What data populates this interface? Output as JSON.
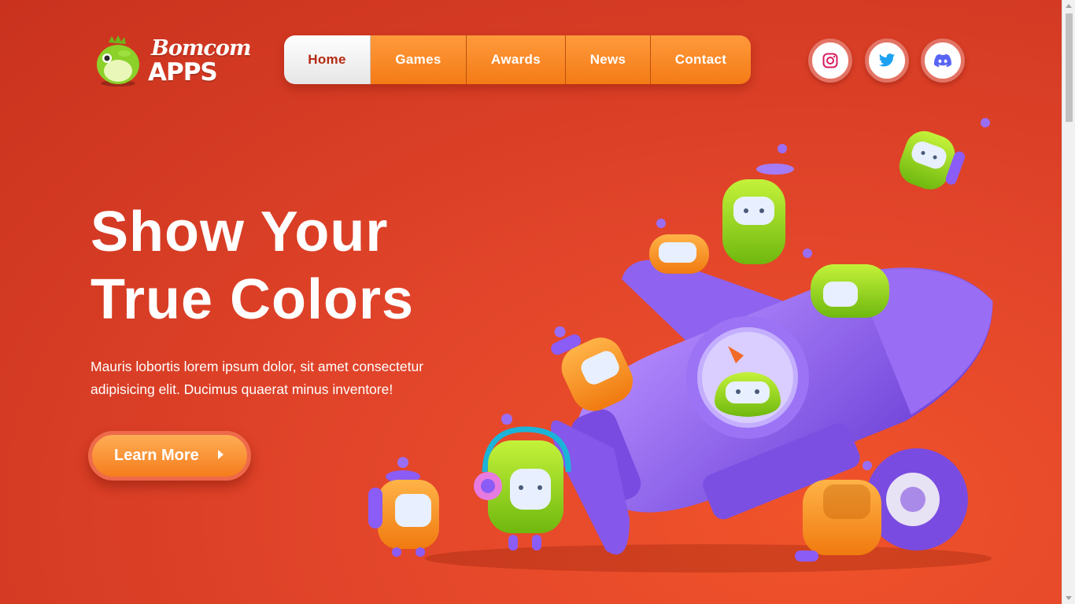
{
  "logo": {
    "line1": "Bomcom",
    "line2": "APPS",
    "mascot_icon": "dino-mascot-icon"
  },
  "nav": {
    "items": [
      {
        "label": "Home",
        "active": true
      },
      {
        "label": "Games",
        "active": false
      },
      {
        "label": "Awards",
        "active": false
      },
      {
        "label": "News",
        "active": false
      },
      {
        "label": "Contact",
        "active": false
      }
    ]
  },
  "social": [
    {
      "name": "instagram",
      "icon": "instagram-icon",
      "color": "#e1306c"
    },
    {
      "name": "twitter",
      "icon": "twitter-icon",
      "color": "#1da1f2"
    },
    {
      "name": "discord",
      "icon": "discord-icon",
      "color": "#7289da"
    }
  ],
  "hero": {
    "title_line1": "Show Your",
    "title_line2": "True Colors",
    "description": "Mauris lobortis lorem ipsum dolor, sit amet consectetur adipisicing elit. Ducimus quaerat minus inventore!",
    "cta_label": "Learn More",
    "cta_icon": "caret-right-icon"
  },
  "illustration": {
    "subject": "rocket-with-robot-characters",
    "colors": {
      "rocket": "#8b5cf6",
      "robot_orange": "#f7931e",
      "robot_green": "#8fd11a",
      "background": "#e2452a"
    }
  },
  "colors": {
    "accent": "#f47b16",
    "brand_red": "#b52a13",
    "text": "#ffffff"
  }
}
